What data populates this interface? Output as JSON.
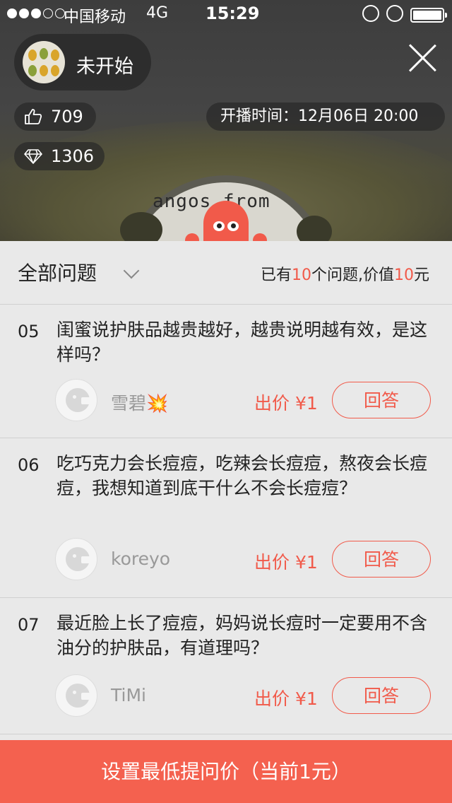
{
  "status_bar": {
    "carrier": "中国移动",
    "network": "4G",
    "time": "15:29"
  },
  "host": {
    "status": "未开始"
  },
  "stats": {
    "likes": "709",
    "diamonds": "1306",
    "start_time": "开播时间：12月06日  20:00"
  },
  "video": {
    "plate_text": "angos from"
  },
  "panel": {
    "filter_label": "全部问题",
    "summary_prefix": "已有",
    "summary_count": "10",
    "summary_mid": "个问题,价值",
    "summary_value": "10",
    "summary_suffix": "元"
  },
  "questions": [
    {
      "num": "05",
      "text": "闺蜜说护肤品越贵越好，越贵说明越有效，是这样吗？",
      "user": "雪碧💥",
      "price": "出价 ¥1",
      "answer_label": "回答"
    },
    {
      "num": "06",
      "text": "吃巧克力会长痘痘，吃辣会长痘痘，熬夜会长痘痘，我想知道到底干什么不会长痘痘？",
      "user": "koreyo",
      "price": "出价 ¥1",
      "answer_label": "回答"
    },
    {
      "num": "07",
      "text": "最近脸上长了痘痘，妈妈说长痘时一定要用不含油分的护肤品，有道理吗？",
      "user": "TiMi",
      "price": "出价 ¥1",
      "answer_label": "回答"
    }
  ],
  "bottom_button": "设置最低提问价（当前1元）",
  "colors": {
    "accent": "#f15a4a",
    "bottom_bar": "#f4614f"
  }
}
